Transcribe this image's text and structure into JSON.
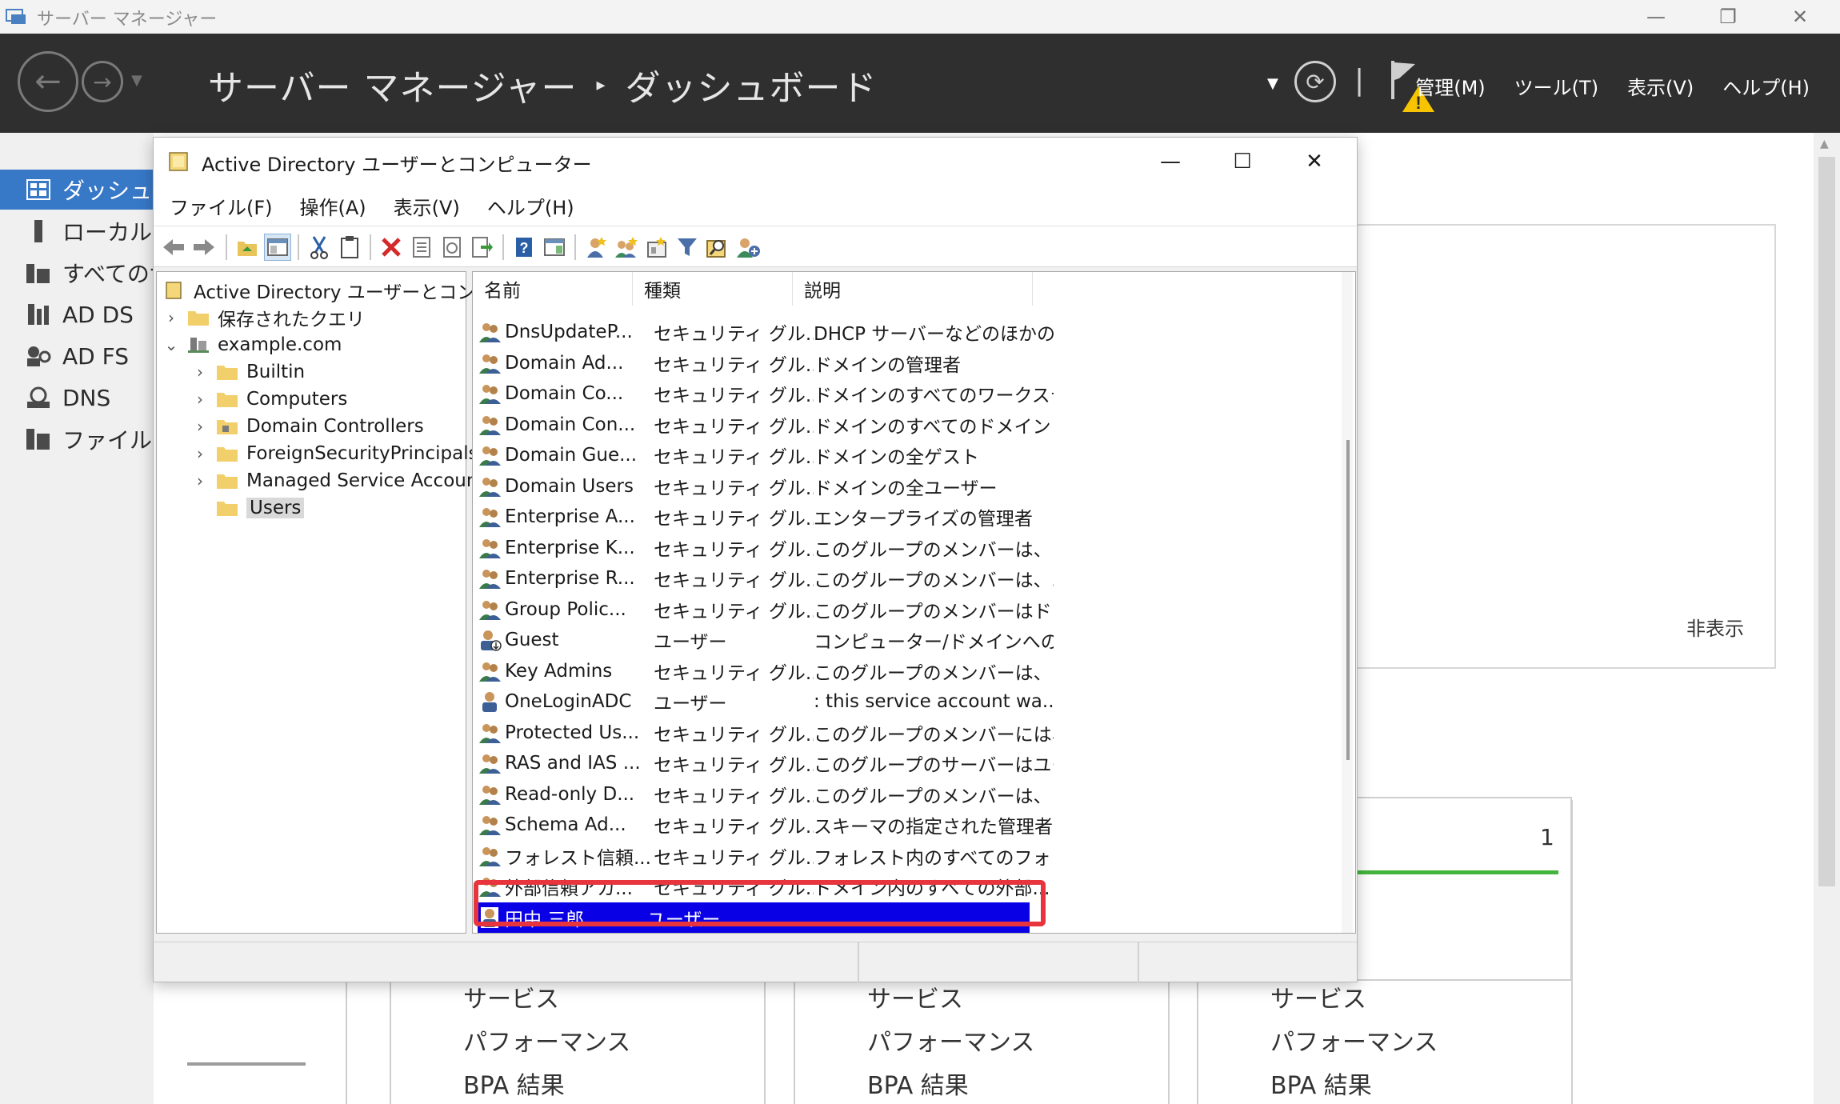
{
  "server_manager": {
    "window_title": "サーバー マネージャー",
    "breadcrumb": {
      "root": "サーバー マネージャー",
      "separator": "▸",
      "current": "ダッシュボード"
    },
    "menu": [
      "管理(M)",
      "ツール(T)",
      "表示(V)",
      "ヘルプ(H)"
    ],
    "nav": [
      {
        "label": "ダッシュボード",
        "icon": "dashboard-icon"
      },
      {
        "label": "ローカル サーバー",
        "icon": "server-icon"
      },
      {
        "label": "すべてのサーバー",
        "icon": "servers-icon"
      },
      {
        "label": "AD DS",
        "icon": "ad-ds-icon"
      },
      {
        "label": "AD FS",
        "icon": "ad-fs-icon"
      },
      {
        "label": "DNS",
        "icon": "dns-icon"
      },
      {
        "label": "ファイル サービス",
        "icon": "file-services-icon"
      }
    ],
    "hide_link": "非表示",
    "tile_count": "1",
    "tile_rows": [
      "サービス",
      "パフォーマンス",
      "BPA 結果"
    ]
  },
  "aduc": {
    "window_title": "Active Directory ユーザーとコンピューター",
    "menu": [
      "ファイル(F)",
      "操作(A)",
      "表示(V)",
      "ヘルプ(H)"
    ],
    "tree": {
      "root": "Active Directory ユーザーとコンピュータ",
      "saved_queries": "保存されたクエリ",
      "domain": "example.com",
      "children": [
        "Builtin",
        "Computers",
        "Domain Controllers",
        "ForeignSecurityPrincipals",
        "Managed Service Accounts",
        "Users"
      ],
      "selected": "Users"
    },
    "columns": [
      "名前",
      "種類",
      "説明"
    ],
    "rows": [
      {
        "name": "DnsUpdateP...",
        "type": "セキュリティ グル...",
        "desc": "DHCP サーバーなどのほかの...",
        "kind": "group"
      },
      {
        "name": "Domain Ad...",
        "type": "セキュリティ グル...",
        "desc": "ドメインの管理者",
        "kind": "group"
      },
      {
        "name": "Domain Co...",
        "type": "セキュリティ グル...",
        "desc": "ドメインのすべてのワークステ...",
        "kind": "group"
      },
      {
        "name": "Domain Con...",
        "type": "セキュリティ グル...",
        "desc": "ドメインのすべてのドメイン コ...",
        "kind": "group"
      },
      {
        "name": "Domain Gue...",
        "type": "セキュリティ グル...",
        "desc": "ドメインの全ゲスト",
        "kind": "group"
      },
      {
        "name": "Domain Users",
        "type": "セキュリティ グル...",
        "desc": "ドメインの全ユーザー",
        "kind": "group"
      },
      {
        "name": "Enterprise A...",
        "type": "セキュリティ グル...",
        "desc": "エンタープライズの管理者",
        "kind": "group"
      },
      {
        "name": "Enterprise K...",
        "type": "セキュリティ グル...",
        "desc": "このグループのメンバーは、フ...",
        "kind": "group"
      },
      {
        "name": "Enterprise R...",
        "type": "セキュリティ グル...",
        "desc": "このグループのメンバーは、エ...",
        "kind": "group"
      },
      {
        "name": "Group Polic...",
        "type": "セキュリティ グル...",
        "desc": "このグループのメンバーはドメ...",
        "kind": "group"
      },
      {
        "name": "Guest",
        "type": "ユーザー",
        "desc": "コンピューター/ドメインへのゲ...",
        "kind": "user-disabled"
      },
      {
        "name": "Key Admins",
        "type": "セキュリティ グル...",
        "desc": "このグループのメンバーは、ド...",
        "kind": "group"
      },
      {
        "name": "OneLoginADC",
        "type": "ユーザー",
        "desc": ": this service account wa...",
        "kind": "user"
      },
      {
        "name": "Protected Us...",
        "type": "セキュリティ グル...",
        "desc": "このグループのメンバーには、...",
        "kind": "group"
      },
      {
        "name": "RAS and IAS ...",
        "type": "セキュリティ グル...",
        "desc": "このグループのサーバーはユー...",
        "kind": "group"
      },
      {
        "name": "Read-only D...",
        "type": "セキュリティ グル...",
        "desc": "このグループのメンバーは、ド...",
        "kind": "group"
      },
      {
        "name": "Schema Ad...",
        "type": "セキュリティ グル...",
        "desc": "スキーマの指定された管理者",
        "kind": "group"
      },
      {
        "name": "フォレスト信頼...",
        "type": "セキュリティ グル...",
        "desc": "フォレスト内のすべてのフォレ...",
        "kind": "group"
      },
      {
        "name": "外部信頼アカ...",
        "type": "セキュリティ グル...",
        "desc": "ドメイン内のすべての外部...",
        "kind": "group"
      },
      {
        "name": "田中 三郎",
        "type": "ユーザー",
        "desc": "",
        "kind": "user",
        "selected": true
      }
    ]
  },
  "colors": {
    "sm_header": "#2f2f2f",
    "nav_active": "#3778c7",
    "selection": "#0a00e6",
    "highlight": "#e8343d",
    "tile_green": "#43b43b"
  }
}
